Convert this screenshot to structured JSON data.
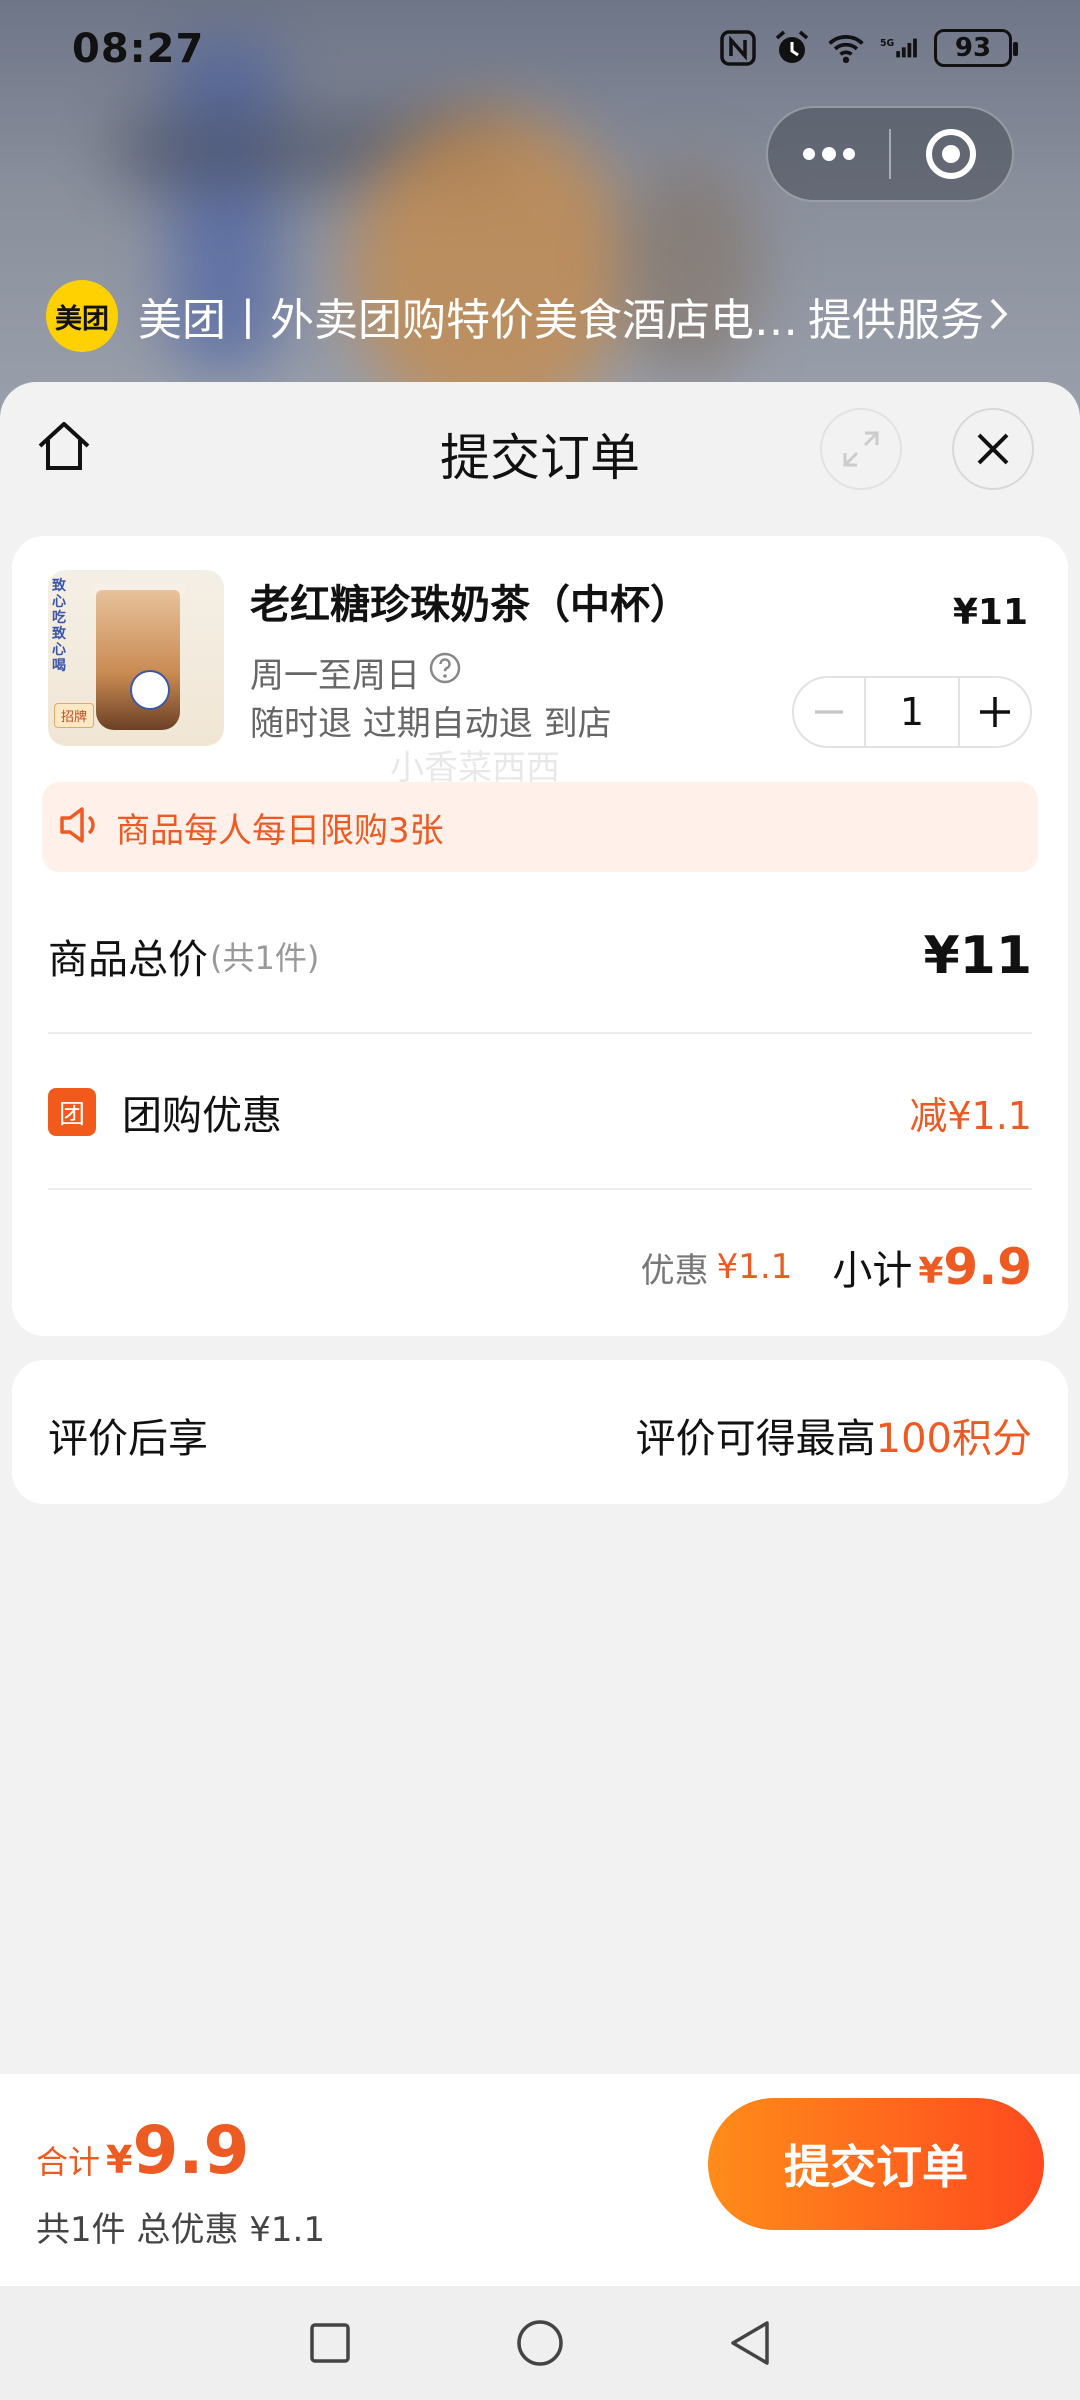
{
  "status_bar": {
    "time": "08:27",
    "battery": "93",
    "icons": [
      "nfc-icon",
      "alarm-icon",
      "wifi-icon",
      "signal-5g-icon",
      "battery-icon"
    ]
  },
  "capsule": {
    "more_icon": "more-dots-icon",
    "close_icon": "target-circle-icon"
  },
  "provider": {
    "logo_text": "美团",
    "name": "美团丨外卖团购特价美食酒店电…",
    "suffix": "提供服务"
  },
  "header": {
    "title": "提交订单",
    "home_icon": "home-icon",
    "expand_icon": "expand-icon",
    "close_icon": "close-icon"
  },
  "product": {
    "name": "老红糖珍珠奶茶（中杯）",
    "price": "¥11",
    "days": "周一至周日",
    "tags": "随时退 过期自动退 到店",
    "quantity": "1",
    "image_text": "致心吃 致心喝",
    "image_badge": "招牌"
  },
  "notice": {
    "text": "商品每人每日限购3张",
    "icon": "speaker-icon"
  },
  "summary": {
    "total_label": "商品总价",
    "total_count": "(共1件)",
    "total_value": "¥11",
    "discount_icon_text": "团",
    "discount_label": "团购优惠",
    "discount_value": "减¥1.1",
    "youhui_label": "优惠",
    "youhui_value": "¥1.1",
    "subtotal_label": "小计",
    "subtotal_currency": "¥",
    "subtotal_value": "9.9"
  },
  "watermark": "小香菜西西",
  "review": {
    "label": "评价后享",
    "text": "评价可得最高",
    "points": "100积分"
  },
  "bottom": {
    "total_label": "合计",
    "currency": "¥",
    "total_value": "9.9",
    "summary": "共1件 总优惠 ¥1.1",
    "submit_label": "提交订单"
  },
  "colors": {
    "accent": "#ed5b22",
    "button_gradient_start": "#ff8c1a",
    "button_gradient_end": "#ff4a1f",
    "brand_yellow": "#ffd100"
  }
}
